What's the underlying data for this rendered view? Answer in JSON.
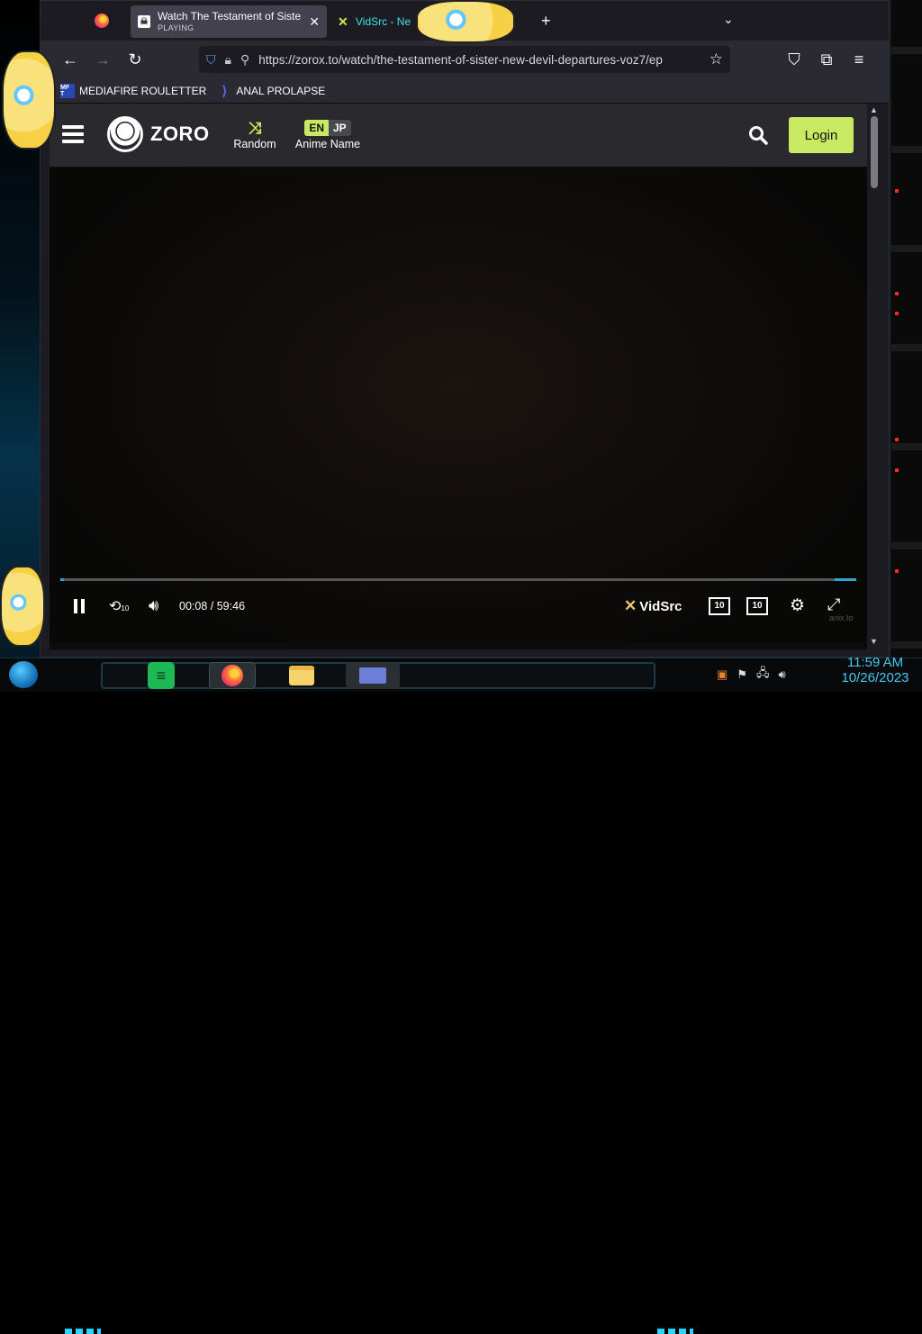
{
  "browser": {
    "tabs": [
      {
        "title": "Watch The Testament of Sister New Devil Departures",
        "subtitle": "PLAYING",
        "active": true
      },
      {
        "title": "VidSrc - Ne",
        "active": false
      }
    ],
    "new_tab_symbol": "+",
    "url": "https://zorox.to/watch/the-testament-of-sister-new-devil-departures-voz7/ep",
    "bookmarks": [
      {
        "label": "MEDIAFIRE ROULETTER",
        "icon_text": "MF T"
      },
      {
        "label": "ANAL PROLAPSE"
      }
    ]
  },
  "site": {
    "logo_text": "ZORO",
    "random_label": "Random",
    "anime_name_label": "Anime Name",
    "lang_en": "EN",
    "lang_jp": "JP",
    "login_label": "Login",
    "accent_color": "#cae962"
  },
  "player": {
    "current_time": "00:08",
    "time_separator": "/",
    "duration": "59:46",
    "progress_fraction": 0.002,
    "skip_back_label": "10",
    "skip_fwd_label": "10",
    "rewind_label": "10",
    "brand": "VidSrc",
    "watermark": "anix.to"
  },
  "taskbar": {
    "time": "11:59 AM",
    "date": "10/26/2023"
  }
}
